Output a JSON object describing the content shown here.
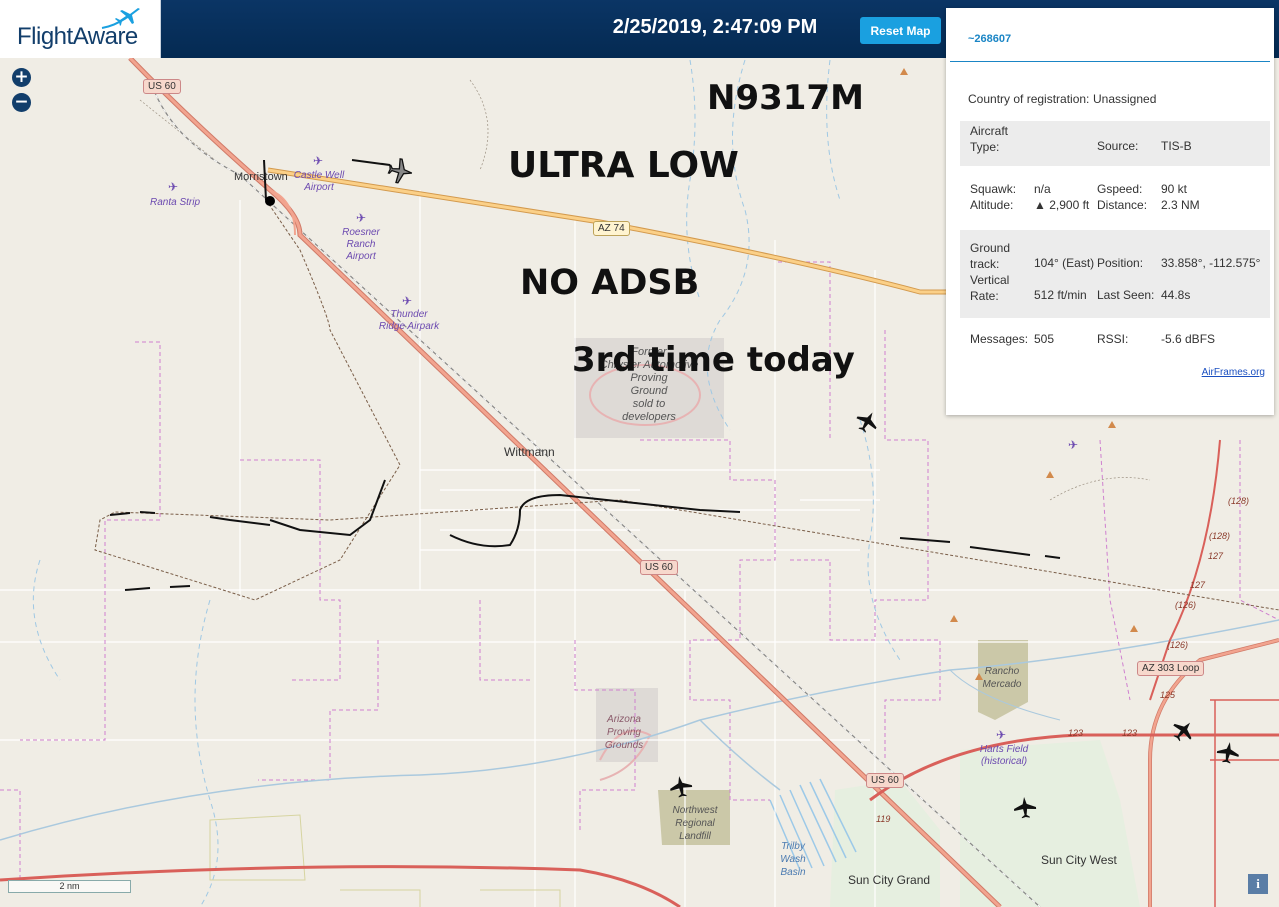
{
  "header": {
    "logo_text": "FlightAware",
    "timestamp": "2/25/2019, 2:47:09 PM",
    "reset_label": "Reset Map"
  },
  "zoom": {
    "in": "+",
    "out": "−"
  },
  "annotations": {
    "tail": "N9317M",
    "line1": "ULTRA LOW",
    "line2": "NO ADSB",
    "line3": "3rd time today"
  },
  "places": {
    "morristown": "Morristown",
    "wittmann": "Wittmann",
    "sun_city_west": "Sun City West",
    "sun_city_grand": "Sun City Grand",
    "castle_well": "Castle Well\nAirport",
    "ranta": "Ranta Strip",
    "roesner": "Roesner\nRanch\nAirport",
    "thunder": "Thunder\nRidge Airpark",
    "harts": "Harts Field\n(historical)",
    "proving_former": "Former\nChrysler Automotive\nProving\nGround\nsold to\ndevelopers",
    "arizona_proving": "Arizona\nProving\nGrounds",
    "landfill": "Northwest\nRegional\nLandfill",
    "rancho": "Rancho\nMercado",
    "trilby": "Trilby\nWash\nBasin"
  },
  "roads": {
    "us60_a": "US 60",
    "us60_b": "US 60",
    "us60_c": "US 60",
    "az74": "AZ 74",
    "az303": "AZ 303 Loop"
  },
  "route_numbers": [
    "(128)",
    "(128)",
    "127",
    "127",
    "(126)",
    "(126)",
    "125",
    "123",
    "123",
    "119"
  ],
  "panel": {
    "hex": "~268607",
    "country_label": "Country of registration:",
    "country_value": "Unassigned",
    "aircraft_type_label": "Aircraft\nType:",
    "aircraft_type_value": "",
    "source_label": "Source:",
    "source_value": "TIS-B",
    "squawk_label": "Squawk:",
    "squawk_value": "n/a",
    "gspeed_label": "Gspeed:",
    "gspeed_value": "90 kt",
    "altitude_label": "Altitude:",
    "altitude_value": "▲ 2,900 ft",
    "distance_label": "Distance:",
    "distance_value": "2.3 NM",
    "track_label": "Ground\ntrack:",
    "track_value": "104° (East)",
    "position_label": "Position:",
    "position_value": "33.858°, -112.575°",
    "vrate_label": "Vertical\nRate:",
    "vrate_value": "512 ft/min",
    "lastseen_label": "Last Seen:",
    "lastseen_value": "44.8s",
    "messages_label": "Messages:",
    "messages_value": "505",
    "rssi_label": "RSSI:",
    "rssi_value": "-5.6 dBFS",
    "link": "AirFrames.org"
  },
  "scale_label": "2 nm",
  "info_label": "i",
  "colors": {
    "header": "#063060",
    "accent": "#1aa0e0",
    "highway": "#e8927c",
    "state_road": "#f5c16c",
    "track": "#111111"
  }
}
